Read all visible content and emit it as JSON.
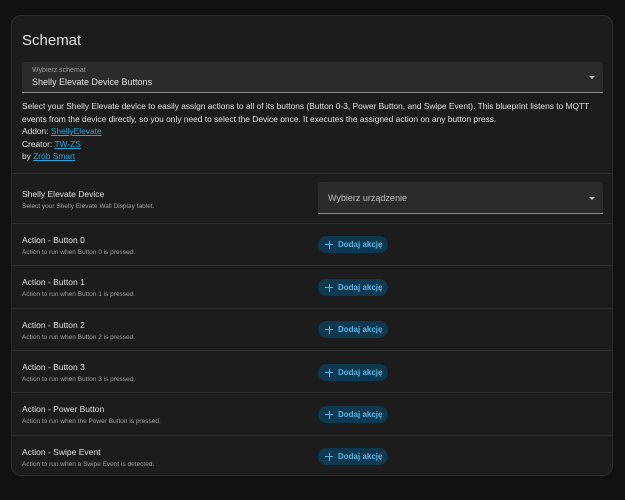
{
  "card": {
    "title": "Schemat"
  },
  "blueprint_select": {
    "label": "Wybierz schemat",
    "value": "Shelly Elevate Device Buttons"
  },
  "description": {
    "text": "Select your Shelly Elevate device to easily assign actions to all of its buttons (Button 0-3, Power Button, and Swipe Event). This blueprint listens to MQTT events from the device directly, so you only need to select the Device once. It executes the assigned action on any button press.",
    "addon_label": "Addon: ",
    "addon_link": "ShellyElevate",
    "creator_label": "Creator: ",
    "creator_link": "TW-ZS",
    "by_label": "by ",
    "by_link": "Zrób Smart"
  },
  "device": {
    "title": "Shelly Elevate Device",
    "subtitle": "Select your Shelly Elevate Wall Display tablet.",
    "placeholder": "Wybierz urządzenie"
  },
  "actions": [
    {
      "title": "Action - Button 0",
      "subtitle": "Action to run when Button 0 is pressed.",
      "button": "Dodaj akcję"
    },
    {
      "title": "Action - Button 1",
      "subtitle": "Action to run when Button 1 is pressed.",
      "button": "Dodaj akcję"
    },
    {
      "title": "Action - Button 2",
      "subtitle": "Action to run when Button 2 is pressed.",
      "button": "Dodaj akcję"
    },
    {
      "title": "Action - Button 3",
      "subtitle": "Action to run when Button 3 is pressed.",
      "button": "Dodaj akcję"
    },
    {
      "title": "Action - Power Button",
      "subtitle": "Action to run when the Power Button is pressed.",
      "button": "Dodaj akcję"
    },
    {
      "title": "Action - Swipe Event",
      "subtitle": "Action to run when a Swipe Event is detected.",
      "button": "Dodaj akcję"
    }
  ],
  "icons": {
    "dropdown": "chevron-down-icon",
    "add": "plus-icon"
  },
  "colors": {
    "background": "#111111",
    "card": "#1c1c1c",
    "accent": "#54b6e8",
    "link": "#2aa3d8"
  }
}
